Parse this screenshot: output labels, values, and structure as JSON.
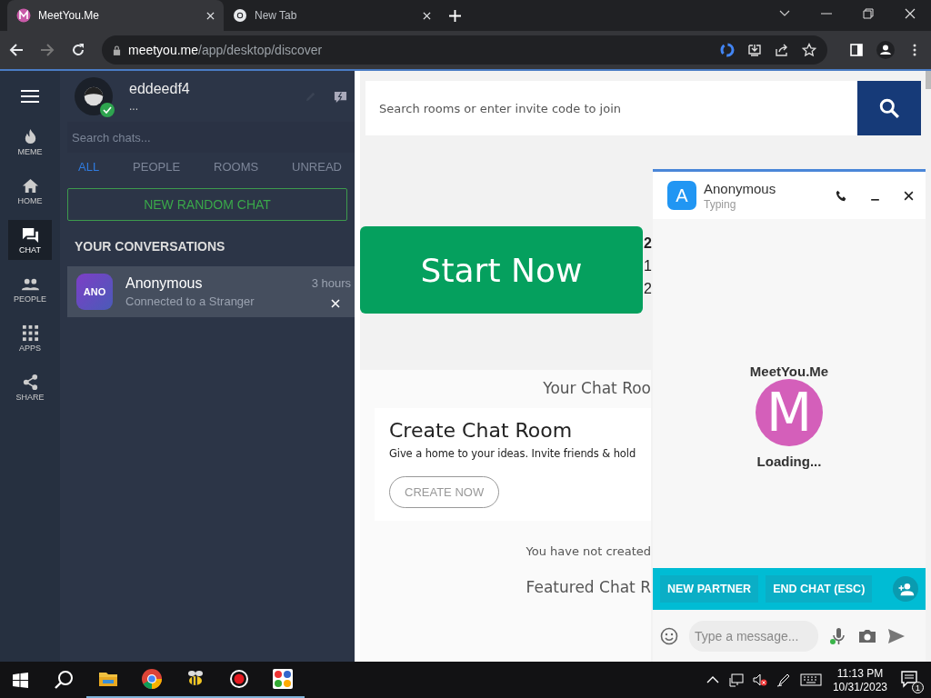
{
  "browser": {
    "tabs": [
      {
        "title": "MeetYou.Me",
        "selected": true,
        "kind": "site"
      },
      {
        "title": "New Tab",
        "selected": false,
        "kind": "chrome"
      }
    ],
    "url_host": "meetyou.me",
    "url_path": "/app/desktop/discover"
  },
  "rail": {
    "items": [
      {
        "label": "MEME",
        "kind": "fire",
        "selected": false
      },
      {
        "label": "HOME",
        "kind": "home",
        "selected": false
      },
      {
        "label": "CHAT",
        "kind": "chat",
        "selected": true
      },
      {
        "label": "PEOPLE",
        "kind": "people",
        "selected": false
      },
      {
        "label": "APPS",
        "kind": "apps",
        "selected": false
      },
      {
        "label": "SHARE",
        "kind": "share",
        "selected": false
      }
    ]
  },
  "profile": {
    "username": "eddeedf4",
    "status": "...",
    "online": true
  },
  "chat_search": {
    "placeholder": "Search chats..."
  },
  "filters": [
    {
      "label": "ALL",
      "selected": true
    },
    {
      "label": "PEOPLE",
      "selected": false
    },
    {
      "label": "ROOMS",
      "selected": false
    },
    {
      "label": "UNREAD",
      "selected": false
    }
  ],
  "new_random_chat": "NEW RANDOM CHAT",
  "conversations_heading": "YOUR CONVERSATIONS",
  "conversations": [
    {
      "avatar": "ANO",
      "name": "Anonymous",
      "preview": "Connected to a Stranger",
      "time": "3 hours",
      "selected": true
    }
  ],
  "room_search": {
    "placeholder": "Search rooms or enter invite code to join"
  },
  "start_button": "Start Now",
  "stats": [
    "2",
    "1",
    "2"
  ],
  "rooms_heading": "Your Chat Roo",
  "create_card": {
    "title": "Create Chat Room",
    "text": "Give a home to your ideas. Invite friends & hold",
    "button": "CREATE NOW"
  },
  "empty_note": "You have not created",
  "featured_heading": "Featured Chat R",
  "chat_window": {
    "avatar": "A",
    "name": "Anonymous",
    "status": "Typing",
    "logo_name": "MeetYou.Me",
    "logo_letter": "M",
    "loading": "Loading...",
    "actions": [
      "NEW PARTNER",
      "END CHAT (ESC)"
    ],
    "message": {
      "placeholder": "Type a message..."
    },
    "mic_active": true
  },
  "taskbar": {
    "apps": [
      {
        "kind": "search",
        "active": false
      },
      {
        "kind": "folder",
        "active": true
      },
      {
        "kind": "chrome",
        "active": true
      },
      {
        "kind": "bee",
        "active": true
      },
      {
        "kind": "record",
        "active": true
      },
      {
        "kind": "dots",
        "active": true
      }
    ],
    "time": "11:13 PM",
    "date": "10/31/2023",
    "notifications": "1"
  }
}
